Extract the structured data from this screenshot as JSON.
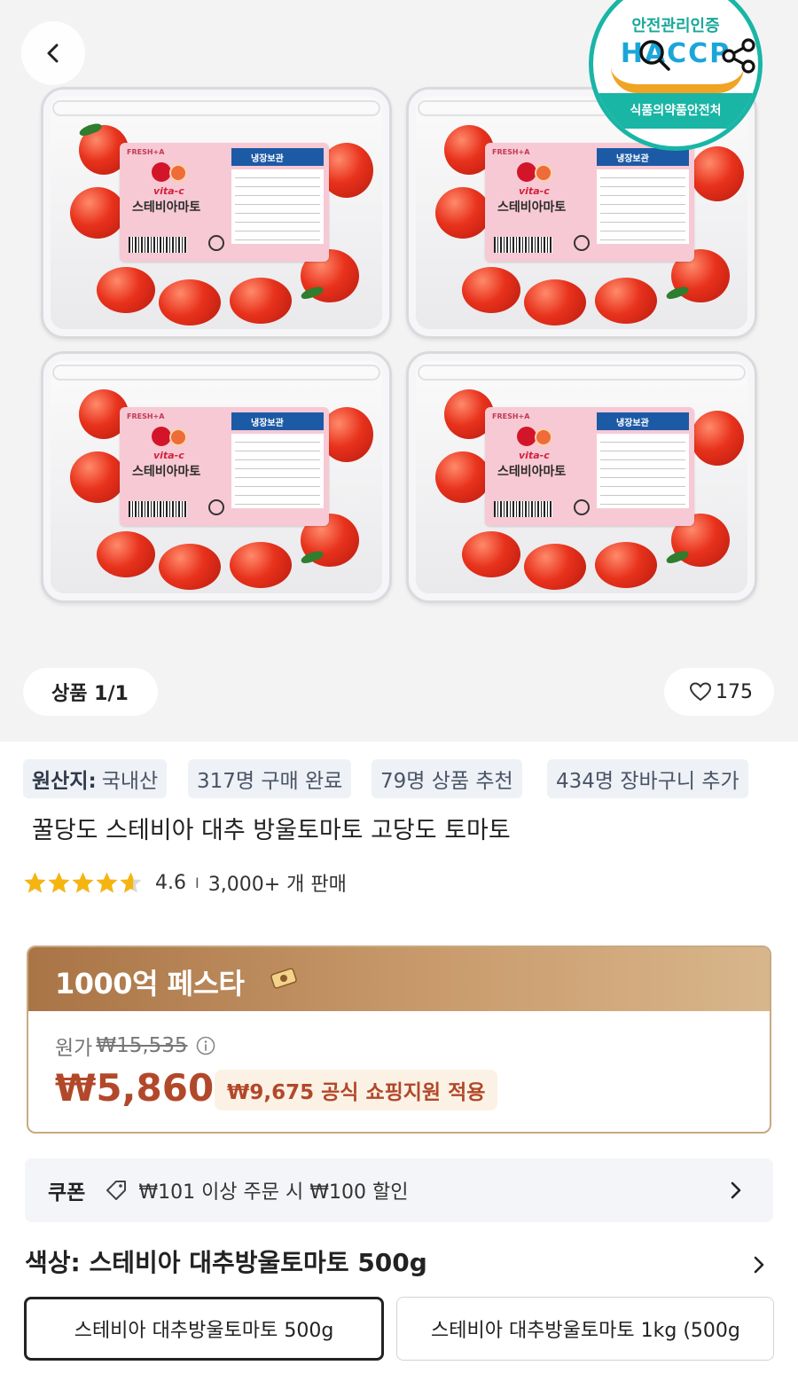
{
  "nav": {
    "back_icon": "chevron-left-icon",
    "search_icon": "search-icon",
    "share_icon": "share-icon"
  },
  "gallery": {
    "counter": "상품 1/1",
    "likes": "175",
    "product_label": {
      "brand": "FRESH+A",
      "cold_storage": "냉장보관",
      "vita": "vita-c",
      "name": "스테비아마토"
    },
    "certification": {
      "top": "안전관리인증",
      "logo": "HACCP",
      "bottom": "식품의약품안전처"
    }
  },
  "chips": {
    "origin_label": "원산지:",
    "origin_value": "국내산",
    "purchases": "317명 구매 완료",
    "recommend": "79명 상품 추천",
    "cart": "434명 장바구니 추가"
  },
  "product": {
    "title": "꿀당도 스테비아 대추 방울토마토 고당도 토마토",
    "rating": "4.6",
    "separator": "I",
    "sold": "3,000+ 개 판매",
    "stars_value": 4.6
  },
  "deal": {
    "banner": "1000억 페스타",
    "original_label": "원가",
    "original_price": "₩15,535",
    "price": "₩5,860",
    "support": "₩9,675 공식 쇼핑지원 적용"
  },
  "coupon": {
    "label": "쿠폰",
    "text": "₩101 이상 주문 시 ₩100 할인"
  },
  "options": {
    "color_label": "색상: 스테비아 대추방울토마토 500g",
    "items": [
      {
        "label": "스테비아 대추방울토마토 500g",
        "selected": true
      },
      {
        "label": "스테비아 대추방울토마토 1kg (500g",
        "selected": false
      }
    ]
  },
  "colors": {
    "price_red": "#b2482a",
    "star_gold": "#f5b511",
    "deal_brown": "#a97446",
    "haccp_teal": "#19b5a5"
  }
}
